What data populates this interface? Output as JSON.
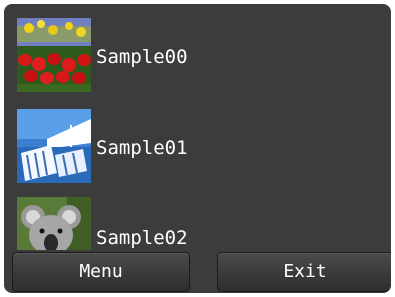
{
  "files": [
    {
      "name": "Sample00",
      "thumbnail": "tulips-photo"
    },
    {
      "name": "Sample01",
      "thumbnail": "beach-chairs-photo"
    },
    {
      "name": "Sample02",
      "thumbnail": "koala-photo"
    }
  ],
  "softkeys": {
    "left_label": "Menu",
    "right_label": "Exit"
  }
}
